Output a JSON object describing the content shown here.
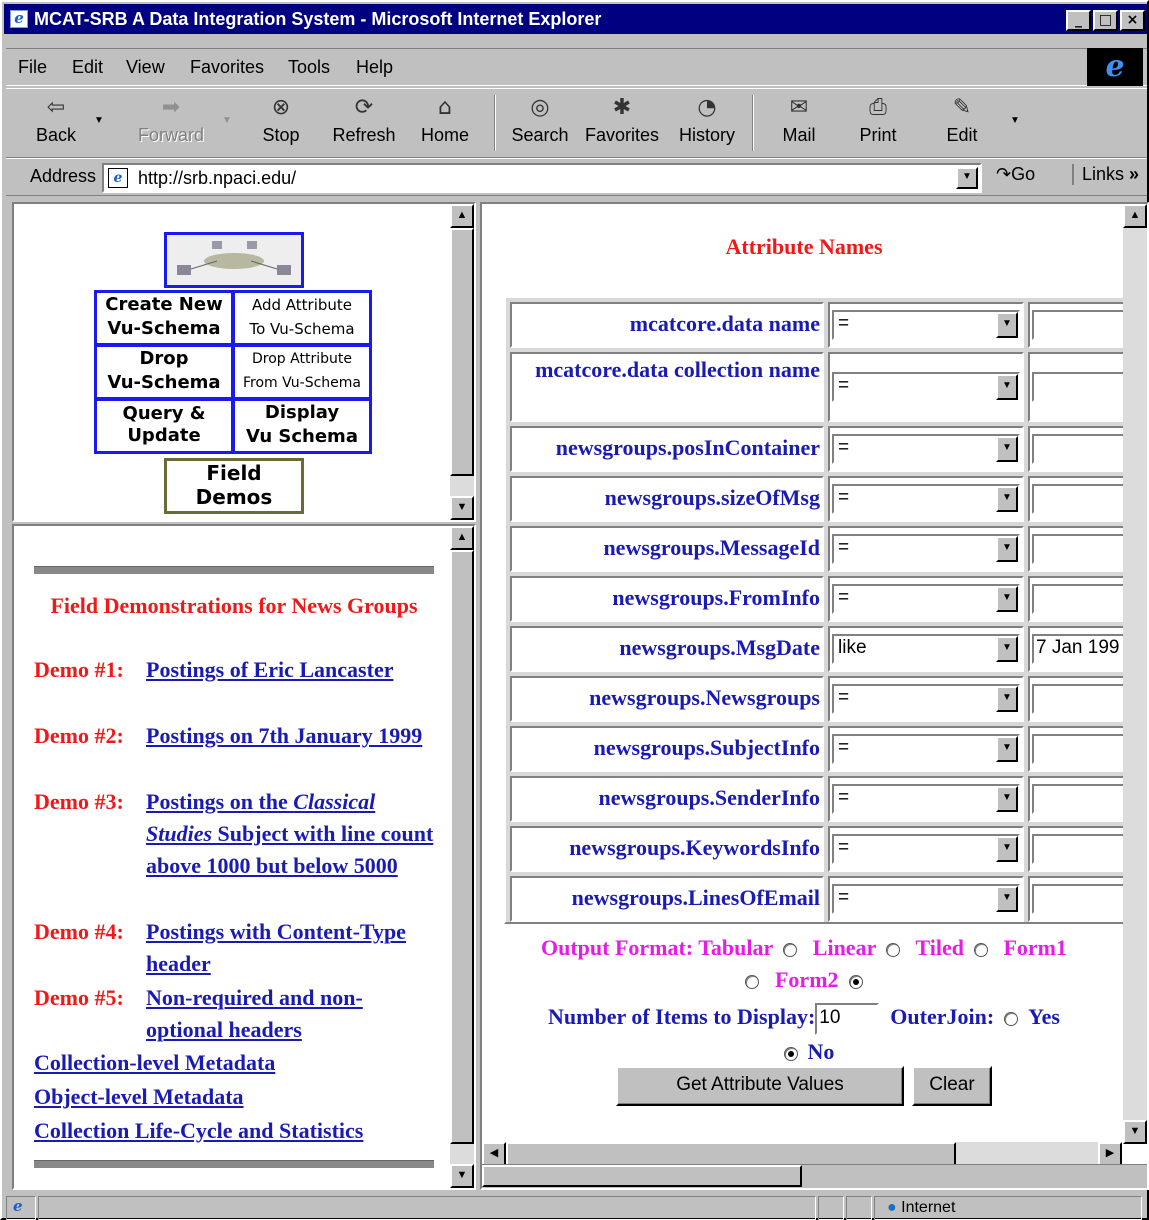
{
  "window": {
    "title": "MCAT-SRB A Data Integration System - Microsoft Internet Explorer",
    "min": "_",
    "max": "□",
    "close": "×"
  },
  "menu": [
    "File",
    "Edit",
    "View",
    "Favorites",
    "Tools",
    "Help"
  ],
  "toolbar": {
    "back": "Back",
    "forward": "Forward",
    "stop": "Stop",
    "refresh": "Refresh",
    "home": "Home",
    "search": "Search",
    "favorites": "Favorites",
    "history": "History",
    "mail": "Mail",
    "print": "Print",
    "edit": "Edit"
  },
  "address": {
    "label": "Address",
    "url": "http://srb.npaci.edu/",
    "go": "Go",
    "links": "Links"
  },
  "nav": {
    "create": [
      "Create New",
      "Vu-Schema"
    ],
    "add": [
      "Add Attribute",
      "To Vu-Schema"
    ],
    "drop": [
      "Drop",
      "Vu-Schema"
    ],
    "dropattr": [
      "Drop Attribute",
      "From Vu-Schema"
    ],
    "query": [
      "Query &",
      "Update"
    ],
    "display": [
      "Display",
      "Vu Schema"
    ],
    "field": [
      "Field",
      "Demos"
    ]
  },
  "left": {
    "title": "Field Demonstrations for News Groups",
    "demos": [
      {
        "label": "Demo #1:",
        "link": "Postings of Eric Lancaster"
      },
      {
        "label": "Demo #2:",
        "link": "Postings on 7th January 1999"
      },
      {
        "label": "Demo #3:",
        "link_pre": "Postings on the ",
        "link_em": "Classical Studies",
        "link_post": " Subject with line count above 1000 but below 5000"
      },
      {
        "label": "Demo #4:",
        "link": "Postings with Content-Type header"
      },
      {
        "label": "Demo #5:",
        "link": "Non-required and non-optional headers"
      }
    ],
    "links": [
      "Collection-level Metadata",
      "Object-level Metadata",
      "Collection Life-Cycle and Statistics"
    ]
  },
  "right": {
    "title": "Attribute Names",
    "rows": [
      {
        "name": "mcatcore.data name",
        "op": "=",
        "value": ""
      },
      {
        "name": "mcatcore.data collection name",
        "op": "=",
        "value": ""
      },
      {
        "name": "newsgroups.posInContainer",
        "op": "=",
        "value": ""
      },
      {
        "name": "newsgroups.sizeOfMsg",
        "op": "=",
        "value": ""
      },
      {
        "name": "newsgroups.MessageId",
        "op": "=",
        "value": ""
      },
      {
        "name": "newsgroups.FromInfo",
        "op": "=",
        "value": ""
      },
      {
        "name": "newsgroups.MsgDate",
        "op": "like",
        "value": "7 Jan 199"
      },
      {
        "name": "newsgroups.Newsgroups",
        "op": "=",
        "value": ""
      },
      {
        "name": "newsgroups.SubjectInfo",
        "op": "=",
        "value": ""
      },
      {
        "name": "newsgroups.SenderInfo",
        "op": "=",
        "value": ""
      },
      {
        "name": "newsgroups.KeywordsInfo",
        "op": "=",
        "value": ""
      },
      {
        "name": "newsgroups.LinesOfEmail",
        "op": "=",
        "value": ""
      }
    ],
    "output_label": "Output Format:",
    "formats": [
      "Tabular",
      "Linear",
      "Tiled",
      "Form1",
      "Form2"
    ],
    "selected_format": "Form2",
    "num_label": "Number of Items to Display:",
    "num_value": "10",
    "outer_label": "OuterJoin:",
    "outer_yes": "Yes",
    "outer_no": "No",
    "outer_selected": "No",
    "btn_get": "Get Attribute Values",
    "btn_clear": "Clear"
  },
  "status": {
    "zone": "Internet"
  }
}
